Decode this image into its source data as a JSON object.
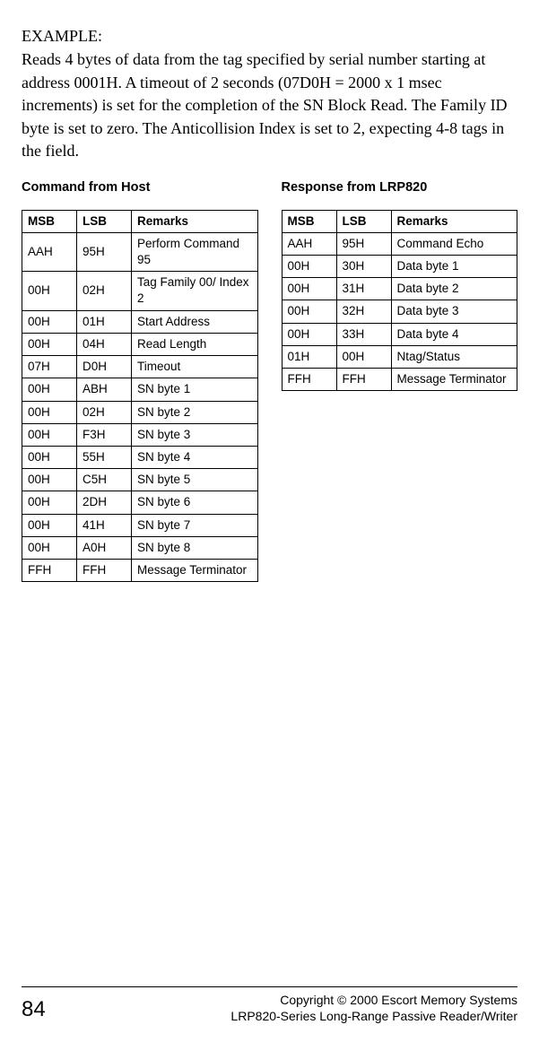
{
  "example": {
    "heading": "EXAMPLE:",
    "body": "Reads 4 bytes of data from the tag specified by serial number starting at address 0001H. A timeout of 2 seconds (07D0H = 2000 x 1 msec increments) is set for the completion of the SN Block Read. The Family ID byte is set to zero.  The Anticollision Index is set to 2, expecting 4-8 tags in the field."
  },
  "command": {
    "title": "Command from Host",
    "headers": {
      "msb": "MSB",
      "lsb": "LSB",
      "remarks": "Remarks"
    },
    "rows": [
      {
        "msb": "AAH",
        "lsb": "95H",
        "remarks": "Perform Command 95"
      },
      {
        "msb": "00H",
        "lsb": "02H",
        "remarks": "Tag Family 00/  Index 2"
      },
      {
        "msb": "00H",
        "lsb": "01H",
        "remarks": "Start Address"
      },
      {
        "msb": "00H",
        "lsb": "04H",
        "remarks": "Read Length"
      },
      {
        "msb": "07H",
        "lsb": "D0H",
        "remarks": "Timeout"
      },
      {
        "msb": "00H",
        "lsb": "ABH",
        "remarks": "SN byte 1"
      },
      {
        "msb": "00H",
        "lsb": "02H",
        "remarks": "SN byte 2"
      },
      {
        "msb": "00H",
        "lsb": "F3H",
        "remarks": "SN byte 3"
      },
      {
        "msb": "00H",
        "lsb": "55H",
        "remarks": "SN byte 4"
      },
      {
        "msb": "00H",
        "lsb": "C5H",
        "remarks": "SN byte 5"
      },
      {
        "msb": "00H",
        "lsb": "2DH",
        "remarks": "SN byte 6"
      },
      {
        "msb": "00H",
        "lsb": "41H",
        "remarks": "SN byte 7"
      },
      {
        "msb": "00H",
        "lsb": "A0H",
        "remarks": "SN byte 8"
      },
      {
        "msb": "FFH",
        "lsb": "FFH",
        "remarks": "Message Terminator"
      }
    ]
  },
  "response": {
    "title": "Response from LRP820",
    "headers": {
      "msb": "MSB",
      "lsb": "LSB",
      "remarks": "Remarks"
    },
    "rows": [
      {
        "msb": "AAH",
        "lsb": "95H",
        "remarks": "Command Echo"
      },
      {
        "msb": "00H",
        "lsb": "30H",
        "remarks": "Data byte 1"
      },
      {
        "msb": "00H",
        "lsb": "31H",
        "remarks": "Data byte 2"
      },
      {
        "msb": "00H",
        "lsb": "32H",
        "remarks": "Data byte 3"
      },
      {
        "msb": "00H",
        "lsb": "33H",
        "remarks": "Data byte 4"
      },
      {
        "msb": "01H",
        "lsb": "00H",
        "remarks": "Ntag/Status"
      },
      {
        "msb": "FFH",
        "lsb": "FFH",
        "remarks": "Message Terminator"
      }
    ]
  },
  "footer": {
    "page": "84",
    "line1": "Copyright © 2000 Escort Memory Systems",
    "line2": "LRP820-Series Long-Range Passive Reader/Writer"
  }
}
